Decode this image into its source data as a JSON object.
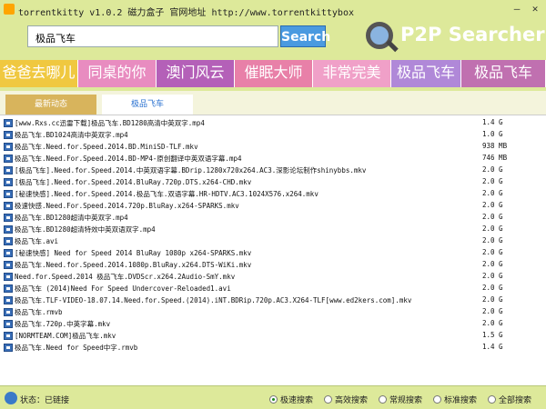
{
  "window": {
    "title": "torrentkitty  v1.0.2  磁力盒子  官网地址 http://www.torrentkittybox",
    "minimize": "—",
    "close": "✕"
  },
  "search": {
    "value": "极品飞车",
    "button_label": "Search"
  },
  "logo": {
    "brand": "P2P Searcher"
  },
  "hot_tags": [
    {
      "label": "爸爸去哪儿",
      "color": "#f0c840"
    },
    {
      "label": "同桌的你",
      "color": "#e88cc0"
    },
    {
      "label": "澳门风云",
      "color": "#b460b8"
    },
    {
      "label": "催眠大师",
      "color": "#e880a8"
    },
    {
      "label": "非常完美",
      "color": "#f0a0c8"
    },
    {
      "label": "极品飞车",
      "color": "#b088d8"
    },
    {
      "label": "极品飞车",
      "color": "#c070b0"
    }
  ],
  "tabs": [
    {
      "label": "最新动态",
      "active": false
    },
    {
      "label": "极品飞车",
      "active": true
    }
  ],
  "results": [
    {
      "name": "[www.Rxs.cc迅雷下载]极品飞车.BD1280高清中英双字.mp4",
      "size": "1.4 G"
    },
    {
      "name": "极品飞车.BD1024高清中英双字.mp4",
      "size": "1.0 G"
    },
    {
      "name": "极品飞车.Need.for.Speed.2014.BD.MiniSD-TLF.mkv",
      "size": "938 MB"
    },
    {
      "name": "极品飞车.Need.For.Speed.2014.BD-MP4-原创翻译中英双语字幕.mp4",
      "size": "746 MB"
    },
    {
      "name": "[极品飞车].Need.for.Speed.2014.中英双语字幕.BDrip.1280x720x264.AC3.深影论坛制作shinybbs.mkv",
      "size": "2.0 G"
    },
    {
      "name": "[极品飞车].Need.for.Speed.2014.BluRay.720p.DTS.x264-CHD.mkv",
      "size": "2.0 G"
    },
    {
      "name": "[秘速快感].Need.for.Speed.2014.极品飞车.双语字幕.HR-HDTV.AC3.1024X576.x264.mkv",
      "size": "2.0 G"
    },
    {
      "name": "极速快感.Need.For.Speed.2014.720p.BluRay.x264-SPARKS.mkv",
      "size": "2.0 G"
    },
    {
      "name": "极品飞车.BD1280超清中英双字.mp4",
      "size": "2.0 G"
    },
    {
      "name": "极品飞车.BD1280超清特效中英双语双字.mp4",
      "size": "2.0 G"
    },
    {
      "name": "极品飞车.avi",
      "size": "2.0 G"
    },
    {
      "name": "[秘速快感] Need for Speed 2014 BluRay 1080p x264-SPARKS.mkv",
      "size": "2.0 G"
    },
    {
      "name": "极品飞车.Need.for.Speed.2014.1080p.BluRay.x264.DTS-WiKi.mkv",
      "size": "2.0 G"
    },
    {
      "name": "Need.for.Speed.2014 极品飞车.DVDScr.x264.2Audio-SmY.mkv",
      "size": "2.0 G"
    },
    {
      "name": "极品飞车 (2014)Need For Speed Undercover-Reloaded1.avi",
      "size": "2.0 G"
    },
    {
      "name": "极品飞车.TLF-VIDEO-18.07.14.Need.for.Speed.(2014).iNT.BDRip.720p.AC3.X264-TLF[www.ed2kers.com].mkv",
      "size": "2.0 G"
    },
    {
      "name": "极品飞车.rmvb",
      "size": "2.0 G"
    },
    {
      "name": "极品飞车.720p.中英字幕.mkv",
      "size": "2.0 G"
    },
    {
      "name": "[NORMTEAM.COM]极品飞车.mkv",
      "size": "1.5 G"
    },
    {
      "name": "极品飞车.Need for Speed中字.rmvb",
      "size": "1.4 G"
    }
  ],
  "status": {
    "text": "状态：已链接",
    "modes": [
      {
        "label": "极速搜索",
        "checked": true
      },
      {
        "label": "高效搜索",
        "checked": false
      },
      {
        "label": "常规搜索",
        "checked": false
      },
      {
        "label": "标准搜索",
        "checked": false
      },
      {
        "label": "全部搜索",
        "checked": false
      }
    ]
  }
}
